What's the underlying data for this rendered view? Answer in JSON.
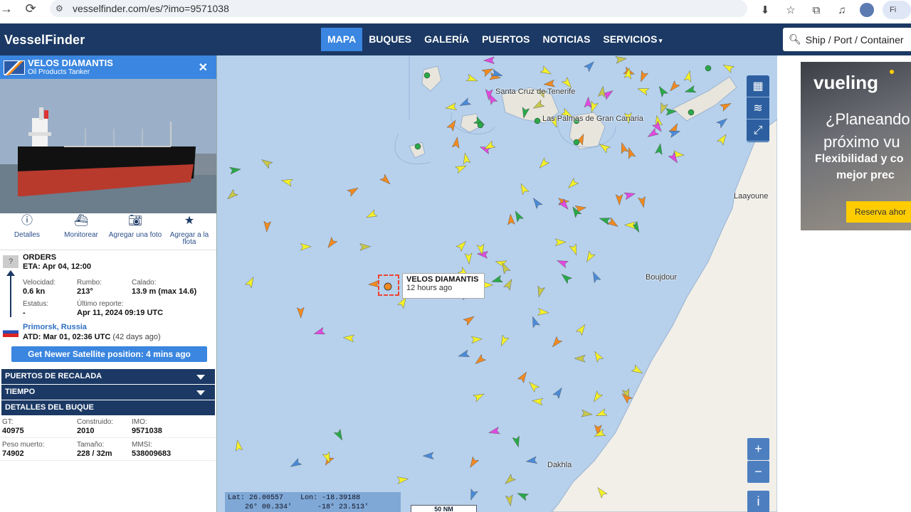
{
  "browser": {
    "url": "vesselfinder.com/es/?imo=9571038",
    "profile_label": "Fi"
  },
  "header": {
    "logo_part1": "Vessel",
    "logo_part2": "Finder",
    "menu": [
      "MAPA",
      "BUQUES",
      "GALERÍA",
      "PUERTOS",
      "NOTICIAS",
      "SERVICIOS"
    ],
    "search_placeholder": "Ship / Port / Container"
  },
  "vessel": {
    "name": "VELOS DIAMANTIS",
    "type": "Oil Products Tanker",
    "actions": [
      "Detalles",
      "Monitorear",
      "Agregar una foto",
      "Agregar a la flota"
    ],
    "destination": "ORDERS",
    "eta": "ETA: Apr 04, 12:00",
    "velocidad_label": "Velocidad:",
    "velocidad": "0.6 kn",
    "rumbo_label": "Rumbo:",
    "rumbo": "213°",
    "calado_label": "Calado:",
    "calado": "13.9 m (max 14.6)",
    "estatus_label": "Estatus:",
    "estatus": "-",
    "reporte_label": "Último reporte:",
    "reporte": "Apr 11, 2024 09:19 UTC",
    "last_port": "Primorsk, Russia",
    "atd": "ATD: Mar 01, 02:36 UTC",
    "atd_ago": "(42 days ago)",
    "sat_button": "Get Newer Satellite position: 4 mins ago",
    "sections": [
      "PUERTOS DE RECALADA",
      "TIEMPO",
      "DETALLES DEL BUQUE"
    ],
    "details": {
      "gt_label": "GT:",
      "gt": "40975",
      "built_label": "Construido:",
      "built": "2010",
      "imo_label": "IMO:",
      "imo": "9571038",
      "dwt_label": "Peso muerto:",
      "dwt": "74902",
      "size_label": "Tamaño:",
      "size": "228 / 32m",
      "mmsi_label": "MMSI:",
      "mmsi": "538009683"
    }
  },
  "map": {
    "labels": {
      "santa_cruz": "Santa Cruz de Tenerife",
      "las_palmas": "Las Palmas de Gran Canaria",
      "laayoune": "Laayoune",
      "boujdour": "Boujdour",
      "dakhla": "Dakhla"
    },
    "tooltip_name": "VELOS DIAMANTIS",
    "tooltip_time": "12 hours ago",
    "lat_label": "Lat:",
    "lat": "26.00557",
    "lat_dms": "26° 00.334'",
    "lon_label": "Lon:",
    "lon": "-18.39188",
    "lon_dms": "-18° 23.513'",
    "scale": "50 NM",
    "zoom_in": "+",
    "zoom_out": "−",
    "info": "i"
  },
  "ad": {
    "brand": "vueling",
    "line1": "¿Planeando",
    "line2": "próximo vu",
    "line3": "Flexibilidad y co",
    "line4": "mejor prec",
    "cta": "Reserva ahor"
  },
  "colors": {
    "navbar": "#1b3964",
    "accent": "#3a86e0",
    "sea": "#b7d1ec",
    "land": "#f2efe9",
    "ad_cta": "#ffcc00"
  }
}
